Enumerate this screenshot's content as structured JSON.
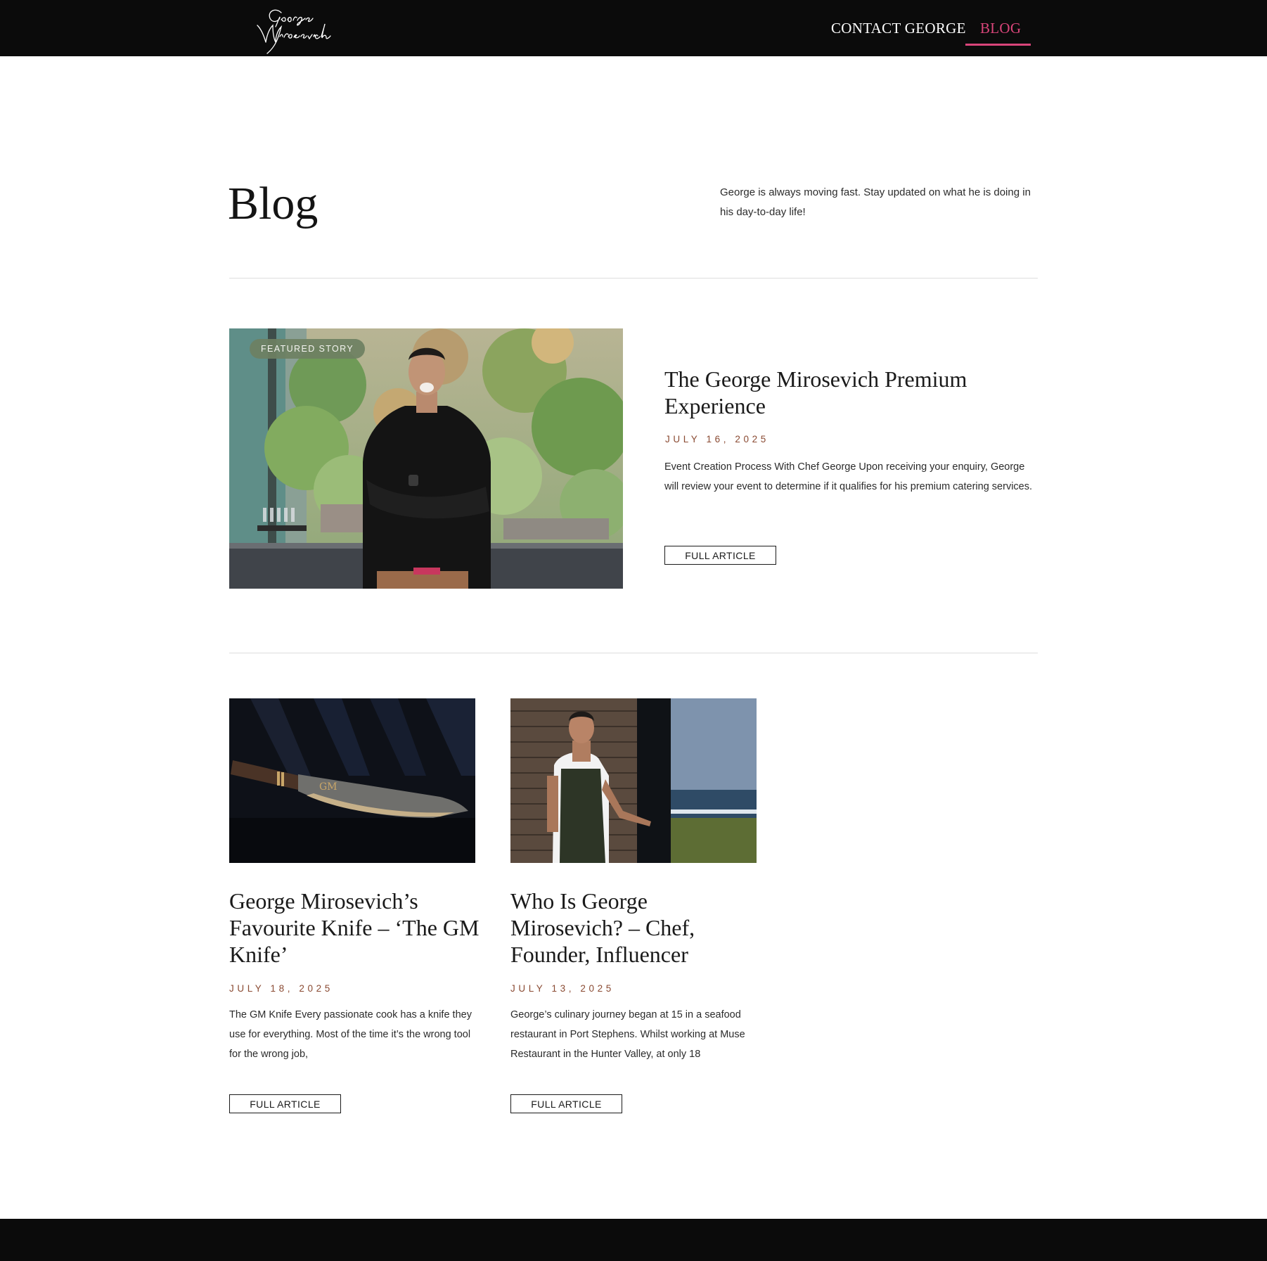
{
  "header": {
    "logo_text": "George Mirosevich",
    "nav": [
      {
        "label": "CONTACT GEORGE",
        "active": false
      },
      {
        "label": "BLOG",
        "active": true
      }
    ],
    "active_color": "#d9457a",
    "background": "#0b0b0b"
  },
  "intro": {
    "title": "Blog",
    "description": "George is always moving fast. Stay updated on what he is doing in his day-to-day life!"
  },
  "featured": {
    "badge": "FEATURED STORY",
    "title": "The George Mirosevich Premium Experience",
    "date": "JULY 16, 2025",
    "excerpt": "Event Creation Process With Chef George Upon receiving your enquiry, George will review your event to determine if it qualifies for his premium catering services.",
    "button": "FULL ARTICLE",
    "image_icon": "chef-portrait-garden-image"
  },
  "posts": [
    {
      "title": "George Mirosevich’s Favourite Knife – ‘The GM Knife’",
      "date": "JULY 18, 2025",
      "excerpt": "The GM Knife Every passionate cook has a knife they use for everything. Most of the time it’s the wrong tool for the wrong job,",
      "button": "FULL ARTICLE",
      "image_icon": "chef-knife-image"
    },
    {
      "title": "Who Is George Mirosevich? – Chef, Founder, Influencer",
      "date": "JULY 13, 2025",
      "excerpt": "George’s culinary journey began at 15 in a seafood restaurant in Port Stephens. Whilst working at Muse Restaurant in the Hunter Valley, at only 18",
      "button": "FULL ARTICLE",
      "image_icon": "chef-apron-coast-image"
    }
  ],
  "colors": {
    "date": "#8a4a32",
    "badge": "#6e8062",
    "footer": "#0b0b0b"
  }
}
